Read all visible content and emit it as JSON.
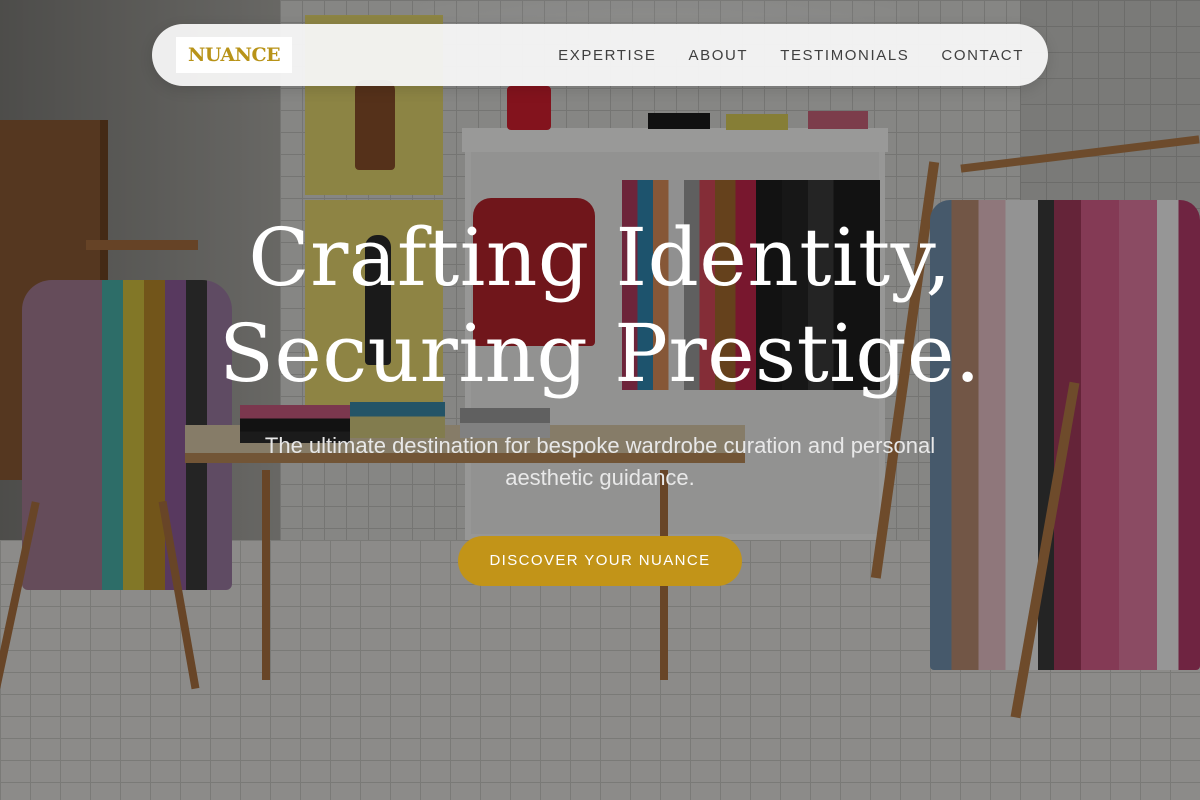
{
  "nav": {
    "logo": "NUANCE",
    "links": [
      {
        "label": "EXPERTISE"
      },
      {
        "label": "ABOUT"
      },
      {
        "label": "TESTIMONIALS"
      },
      {
        "label": "CONTACT"
      }
    ]
  },
  "hero": {
    "headline_line1": "Crafting Identity,",
    "headline_line2": "Securing Prestige.",
    "subtitle": "The ultimate destination for bespoke wardrobe curation and personal aesthetic guidance.",
    "cta_label": "DISCOVER YOUR NUANCE",
    "background_image": "boutique-interior-photo"
  },
  "colors": {
    "accent_gold": "#c29418",
    "logo_gold": "#b89318",
    "nav_background": "#f8f8f8",
    "nav_text": "#3f3f3f",
    "headline_text": "#ffffff"
  }
}
